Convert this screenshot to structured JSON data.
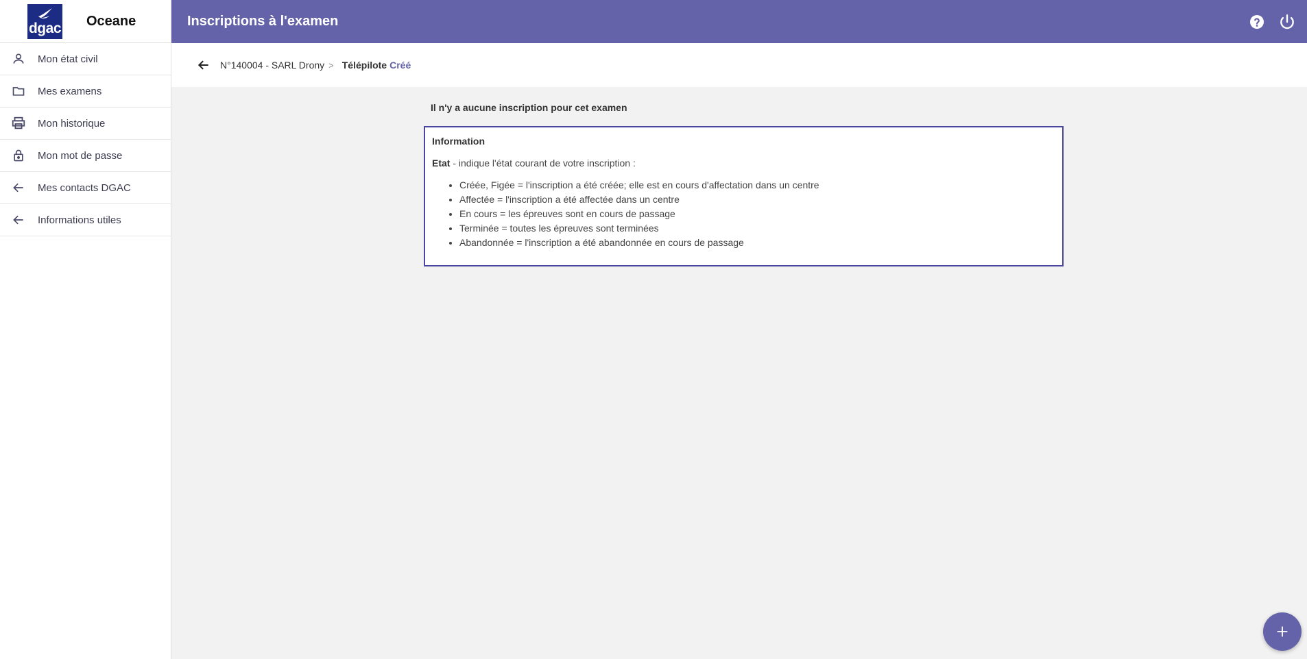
{
  "brand": {
    "logo_text": "dgac",
    "app_name": "Oceane"
  },
  "sidebar": {
    "items": [
      {
        "label": "Mon état civil",
        "icon": "person-icon"
      },
      {
        "label": "Mes examens",
        "icon": "folder-icon"
      },
      {
        "label": "Mon historique",
        "icon": "printer-icon"
      },
      {
        "label": "Mon mot de passe",
        "icon": "lock-icon"
      },
      {
        "label": "Mes contacts DGAC",
        "icon": "arrow-left-icon"
      },
      {
        "label": "Informations utiles",
        "icon": "arrow-left-icon"
      }
    ]
  },
  "header": {
    "title": "Inscriptions à l'examen",
    "help_icon": "help-icon",
    "power_icon": "power-icon"
  },
  "breadcrumb": {
    "parent": "N°140004 - SARL Drony",
    "separator": ">",
    "current": "Télépilote",
    "status": "Créé"
  },
  "main": {
    "empty_message": "Il n'y a aucune inscription pour cet examen",
    "info": {
      "title": "Information",
      "intro_label": "Etat",
      "intro_text": " - indique l'état courant de votre inscription :",
      "items": [
        "Créée, Figée = l'inscription a été créée; elle est en cours d'affectation dans un centre",
        "Affectée = l'inscription a été affectée dans un centre",
        "En cours = les épreuves sont en cours de passage",
        "Terminée = toutes les épreuves sont terminées",
        "Abandonnée = l'inscription a été abandonnée en cours de passage"
      ]
    }
  },
  "colors": {
    "accent": "#6462a8",
    "logo_bg": "#1c2c85",
    "box_border": "#4a46a0"
  }
}
